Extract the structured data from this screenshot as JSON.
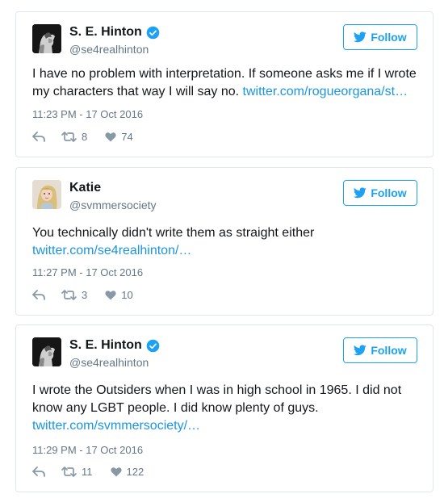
{
  "colors": {
    "accent": "#1da1f2",
    "link": "#1b95e0",
    "secondary_text": "#657786",
    "border": "#e1e8ed"
  },
  "icons": {
    "follow": "twitter-bird-icon",
    "verified": "verified-badge-icon",
    "reply": "reply-icon",
    "retweet": "retweet-icon",
    "like": "heart-icon"
  },
  "tweets": [
    {
      "display_name": "S. E. Hinton",
      "verified": true,
      "handle": "@se4realhinton",
      "follow_label": "Follow",
      "text": "I have no problem with interpretation. If someone asks me if I wrote my characters that way I will say no. ",
      "link": "twitter.com/rogueorgana/st…",
      "timestamp": "11:23 PM - 17 Oct 2016",
      "retweets": "8",
      "likes": "74"
    },
    {
      "display_name": "Katie",
      "verified": false,
      "handle": "@svmmersociety",
      "follow_label": "Follow",
      "text": "You technically didn't write them as straight either ",
      "link": "twitter.com/se4realhinton/…",
      "timestamp": "11:27 PM - 17 Oct 2016",
      "retweets": "3",
      "likes": "10"
    },
    {
      "display_name": "S. E. Hinton",
      "verified": true,
      "handle": "@se4realhinton",
      "follow_label": "Follow",
      "text": "I wrote the Outsiders when I was in high school in 1965. I did not know any LGBT people. I did know plenty of guys. ",
      "link": "twitter.com/svmmersociety/…",
      "timestamp": "11:29 PM - 17 Oct 2016",
      "retweets": "11",
      "likes": "122"
    }
  ]
}
